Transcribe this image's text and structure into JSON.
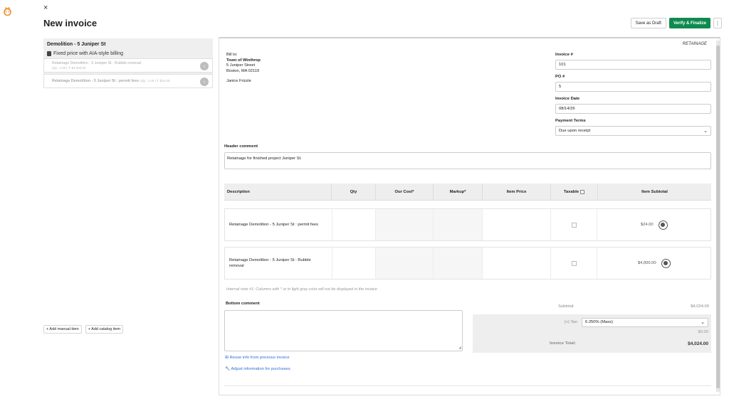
{
  "app": {
    "logo": "owl-logo-icon",
    "close": "×",
    "title": "New invoice"
  },
  "actions": {
    "draft": "Save as Draft",
    "finalize": "Verify & Finalize",
    "more": "⋮"
  },
  "left": {
    "project": "Demolition - 5 Juniper St",
    "billing": "Fixed price with AIA-style billing",
    "items": [
      {
        "label": "Retainage Demolition - 5 Juniper St : Rubble removal",
        "meta": "Qty.: 1.00 | T: $4,000.00"
      },
      {
        "label": "Retainage Demolition - 5 Juniper St : permit fees",
        "meta": "Qty.: 1.00 | T: $24.00"
      }
    ],
    "add_manual": "+ Add manual item",
    "add_catalog": "+ Add catalog item"
  },
  "invoice": {
    "tag": "RETAINAGE",
    "bill_to_label": "Bill to:",
    "bill_to_name": "Town of Winthrop",
    "address1": "5 Juniper Street",
    "address2": "Boston, MA 02119",
    "contact": "Janice Frizzle",
    "invoice_no_label": "Invoice #",
    "invoice_no": "101",
    "po_label": "PO #",
    "po": "5",
    "date_label": "Invoice Date",
    "date": "08/14/26",
    "terms_label": "Payment Terms",
    "terms": "Due upon receipt",
    "header_comment_label": "Header comment",
    "header_comment": "Retainage for finished project Juniper St."
  },
  "table": {
    "headers": {
      "description": "Description",
      "qty": "Qty",
      "cost": "Our Cost*",
      "markup": "Markup*",
      "price": "Item Price",
      "taxable": "Taxable",
      "subtotal": "Item Subtotal"
    },
    "rows": [
      {
        "description": "Retainage Demolition - 5 Juniper St : permit fees",
        "subtotal": "$24.00"
      },
      {
        "description": "Retainage Demolition - 5 Juniper St : Rubble removal",
        "subtotal": "$4,000.00"
      }
    ],
    "note": "Internal note #1: Columns with * or in light gray color will not be displayed in the invoice"
  },
  "bottom": {
    "comment_label": "Bottom comment",
    "reuse": "Reuse info from previous invoice",
    "adjust": "Adjust information for purchases"
  },
  "totals": {
    "subtotal_label": "Subtotal:",
    "subtotal": "$4,024.00",
    "tax_label": "(+) Tax:",
    "tax_rate": "6.250% (Mass)",
    "tax_amount": "$0.00",
    "total_label": "Invoice Total:",
    "total": "$4,024.00"
  },
  "colors": {
    "accent": "#0f8a4f",
    "link": "#2d6fd6",
    "logo": "#f08a24"
  }
}
